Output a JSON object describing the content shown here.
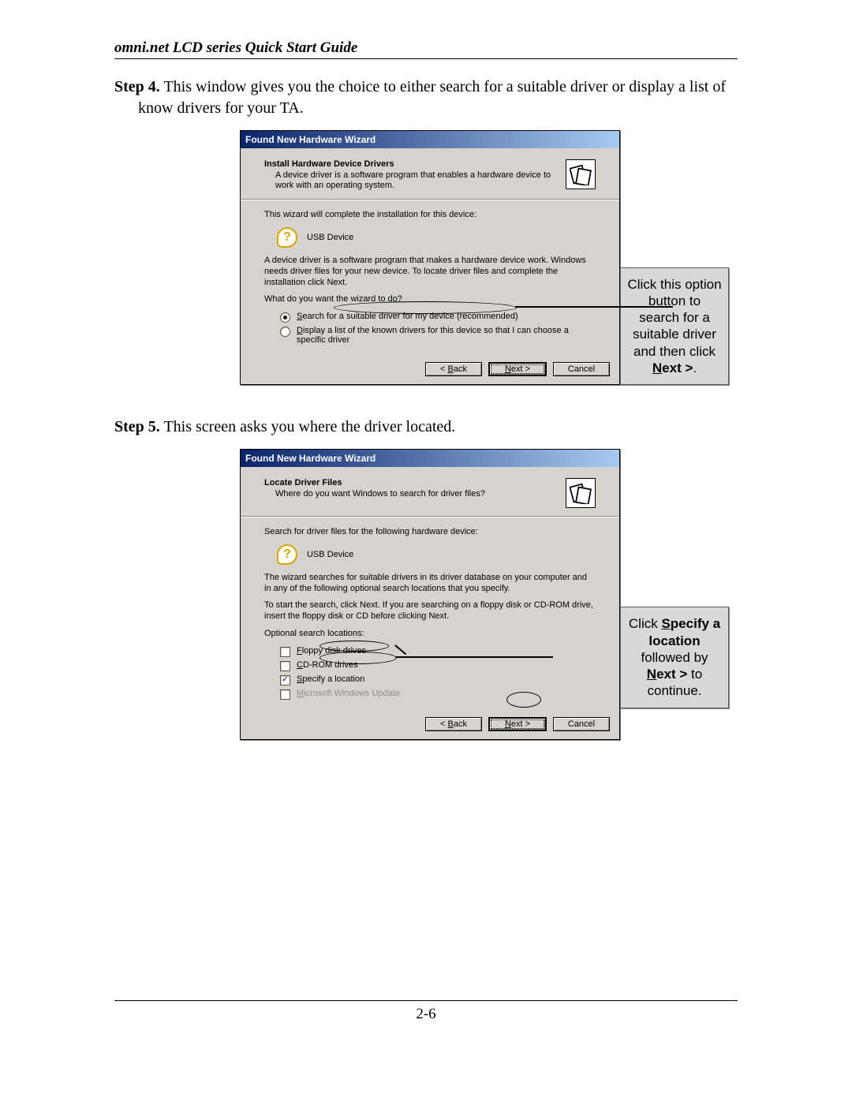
{
  "doc": {
    "header_title": "omni.net LCD series Quick Start Guide",
    "page_number": "2-6"
  },
  "step4": {
    "label": "Step 4.",
    "text": "This window gives you the choice to either search for a suitable driver or display a list of know drivers for your TA."
  },
  "step5": {
    "label": "Step 5.",
    "text": "This screen asks you where the driver located."
  },
  "callout1": {
    "line1": "Click this option button to search for a suitable driver and then click ",
    "next_prefix": "N",
    "next_rest": "ext >",
    "tail": "."
  },
  "callout2": {
    "l1": "Click ",
    "spec_prefix": "S",
    "spec_rest": "pecify a location",
    "l2": " followed by ",
    "next_prefix": "N",
    "next_rest": "ext >",
    "l3": " to continue."
  },
  "dialog1": {
    "title": "Found New Hardware Wizard",
    "header_bold": "Install Hardware Device Drivers",
    "header_sub": "A device driver is a software program that enables a hardware device to work with an operating system.",
    "p1": "This wizard will complete the installation for this device:",
    "device": "USB Device",
    "p2": "A device driver is a software program that makes a hardware device work. Windows needs driver files for your new device. To locate driver files and complete the installation click Next.",
    "p3": "What do you want the wizard to do?",
    "opt1_u": "S",
    "opt1_rest": "earch for a suitable driver for my device (recommended)",
    "opt2_u": "D",
    "opt2_rest": "isplay a list of the known drivers for this device so that I can choose a specific driver",
    "btn_back_u": "B",
    "btn_back_rest": "ack",
    "btn_next_u": "N",
    "btn_next_rest": "ext >",
    "btn_cancel": "Cancel"
  },
  "dialog2": {
    "title": "Found New Hardware Wizard",
    "header_bold": "Locate Driver Files",
    "header_sub": "Where do you want Windows to search for driver files?",
    "p1": "Search for driver files for the following hardware device:",
    "device": "USB Device",
    "p2": "The wizard searches for suitable drivers in its driver database on your computer and in any of the following optional search locations that you specify.",
    "p3": "To start the search, click Next. If you are searching on a floppy disk or CD-ROM drive, insert the floppy disk or CD before clicking Next.",
    "p4": "Optional search locations:",
    "c1_u": "F",
    "c1_rest": "loppy disk drives",
    "c2_u": "C",
    "c2_rest": "D-ROM drives",
    "c3_u": "S",
    "c3_rest": "pecify a location",
    "c4_u": "M",
    "c4_rest": "icrosoft Windows Update",
    "btn_back_u": "B",
    "btn_back_rest": "ack",
    "btn_next_u": "N",
    "btn_next_rest": "ext >",
    "btn_cancel": "Cancel"
  }
}
